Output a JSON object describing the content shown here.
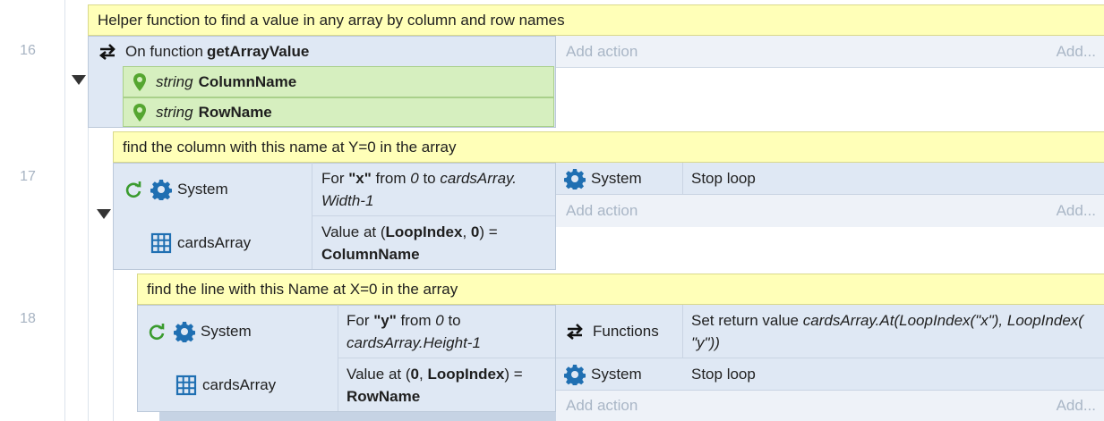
{
  "lines": [
    "16",
    "17",
    "18"
  ],
  "event16": {
    "comment": "Helper function to find a value in any array by column and row names",
    "on_function_prefix": "On function ",
    "function_name": "getArrayValue",
    "params": [
      {
        "type": "string",
        "name": "ColumnName"
      },
      {
        "type": "string",
        "name": "RowName"
      }
    ],
    "add_action": "Add action",
    "add_short": "Add..."
  },
  "event17": {
    "comment": "find the column with this name at Y=0 in the array",
    "cond1_object": "System",
    "cond1_text": {
      "p1": "For ",
      "b1": "\"x\"",
      "p2": " from ",
      "i1": "0",
      "p3": " to ",
      "i2": "cardsArray.",
      "i3": "Width-1"
    },
    "cond2_object": "cardsArray",
    "cond2_text": {
      "p1": "Value at (",
      "b1": "LoopIndex",
      "p2": ", ",
      "b2": "0",
      "p3": ") =",
      "b3": "ColumnName"
    },
    "action1_object": "System",
    "action1_text": "Stop loop",
    "add_action": "Add action",
    "add_short": "Add..."
  },
  "event18": {
    "comment": "find the line with this Name at X=0 in the array",
    "cond1_object": "System",
    "cond1_text": {
      "p1": "For ",
      "b1": "\"y\"",
      "p2": " from ",
      "i1": "0",
      "p3": " to",
      "i2": "cardsArray.Height-1"
    },
    "cond2_object": "cardsArray",
    "cond2_text": {
      "p1": "Value at (",
      "b1": "0",
      "p2": ", ",
      "b2": "LoopIndex",
      "p3": ") =",
      "b3": "RowName"
    },
    "action1_object": "Functions",
    "action1_text": {
      "p1": "Set return value ",
      "i1": "cardsArray.At(LoopIndex(\"x\"), LoopIndex(",
      "i2": "\"y\"))"
    },
    "action2_object": "System",
    "action2_text": "Stop loop",
    "add_action": "Add action",
    "add_short": "Add..."
  },
  "colors": {
    "comment_bg": "#ffffb8",
    "block_bg": "#dfe8f4",
    "param_bg": "#d6efbf",
    "icon_blue": "#1f6fb2",
    "icon_green": "#4caf50"
  }
}
